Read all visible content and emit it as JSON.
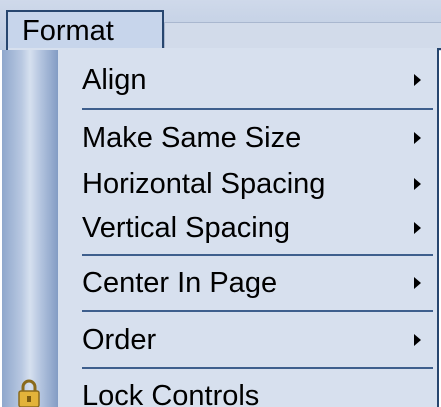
{
  "menubar": {
    "format_label": "Format"
  },
  "menu": {
    "items": [
      {
        "label": "Align",
        "submenu_arrow": true
      },
      {
        "label": "Make Same Size",
        "submenu_arrow": true
      },
      {
        "label": "Horizontal Spacing",
        "submenu_arrow": true
      },
      {
        "label": "Vertical Spacing",
        "submenu_arrow": true
      },
      {
        "label": "Center In Page",
        "submenu_arrow": true
      },
      {
        "label": "Order",
        "submenu_arrow": true
      },
      {
        "label": "Lock Controls",
        "icon": "lock-icon"
      }
    ]
  },
  "colors": {
    "menu_background": "#d7e0ee",
    "border": "#27466f",
    "separator": "#3e5f8d",
    "gutter": "#8fa7cc"
  }
}
